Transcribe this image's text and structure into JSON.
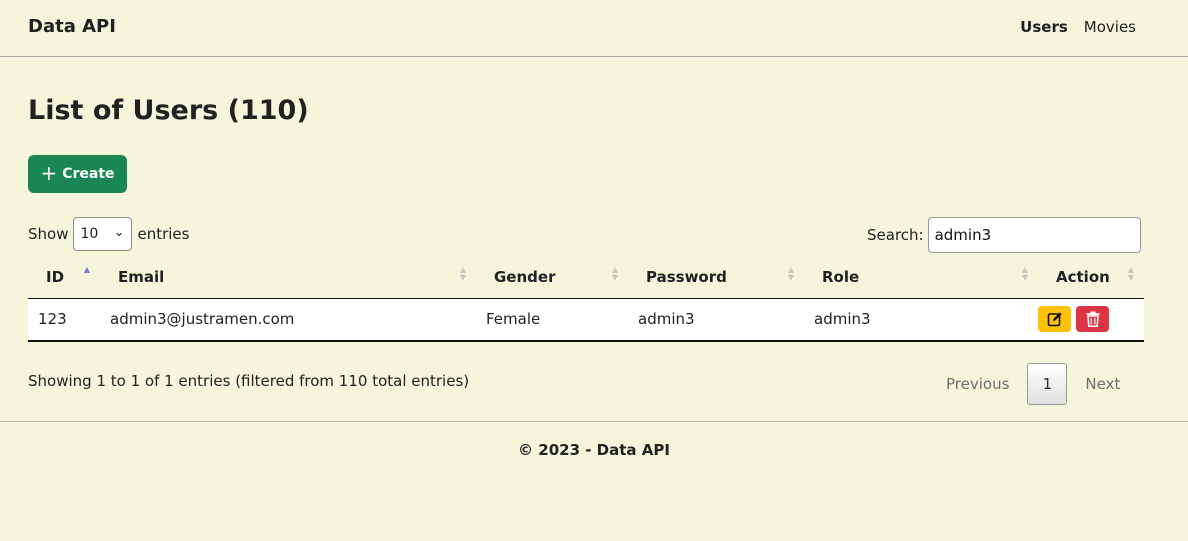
{
  "navbar": {
    "brand": "Data API",
    "links": [
      {
        "label": "Users",
        "active": true
      },
      {
        "label": "Movies",
        "active": false
      }
    ]
  },
  "page": {
    "title": "List of Users (110)",
    "create_label": "Create",
    "create_icon": "plus-icon"
  },
  "length_control": {
    "prefix": "Show",
    "selected": "10",
    "suffix": "entries"
  },
  "search": {
    "label": "Search:",
    "value": "admin3"
  },
  "table": {
    "columns": [
      "ID",
      "Email",
      "Gender",
      "Password",
      "Role",
      "Action"
    ],
    "sorted_column": "ID",
    "sort_direction": "ascending",
    "rows": [
      {
        "id": "123",
        "email": "admin3@justramen.com",
        "gender": "Female",
        "password": "admin3",
        "role": "admin3",
        "actions": [
          "edit-icon",
          "trash-icon"
        ]
      }
    ]
  },
  "info": "Showing 1 to 1 of 1 entries (filtered from 110 total entries)",
  "pagination": {
    "previous": "Previous",
    "current": "1",
    "next": "Next"
  },
  "footer": "© 2023 - Data API",
  "colors": {
    "background": "#f5f5dc",
    "create": "#198754",
    "edit": "#ffc107",
    "delete": "#dc3545"
  }
}
